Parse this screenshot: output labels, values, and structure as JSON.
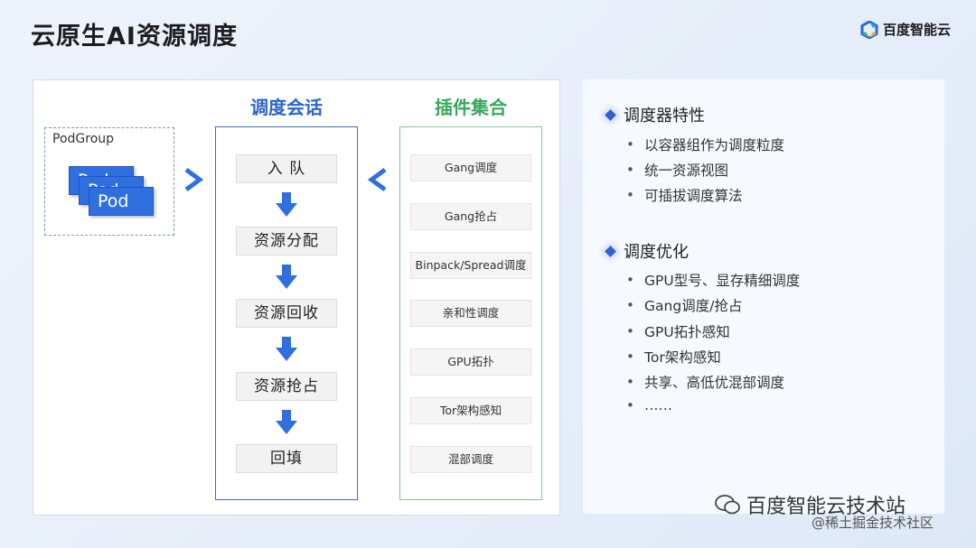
{
  "title": "云原生AI资源调度",
  "brand": {
    "name": "百度智能云",
    "colors": [
      "#1aa5e0",
      "#2c66d6",
      "#3cb371",
      "#f2a93b"
    ]
  },
  "left": {
    "podgroup_label": "PodGroup",
    "pods": [
      "Pod",
      "Pod",
      "Pod"
    ],
    "session": {
      "title": "调度会话",
      "steps": [
        "入 队",
        "资源分配",
        "资源回收",
        "资源抢占",
        "回填"
      ]
    },
    "plugins": {
      "title": "插件集合",
      "items": [
        "Gang调度",
        "Gang抢占",
        "Binpack/Spread调度",
        "亲和性调度",
        "GPU拓扑",
        "Tor架构感知",
        "混部调度"
      ]
    }
  },
  "right": {
    "sections": [
      {
        "title": "调度器特性",
        "items": [
          "以容器组作为调度粒度",
          "统一资源视图",
          "可插拔调度算法"
        ]
      },
      {
        "title": "调度优化",
        "items": [
          "GPU型号、显存精细调度",
          "Gang调度/抢占",
          "GPU拓扑感知",
          "Tor架构感知",
          "共享、高低优混部调度",
          "……"
        ]
      }
    ]
  },
  "watermark": {
    "main": "百度智能云技术站",
    "sub": "@稀土掘金技术社区"
  },
  "colors": {
    "accent_blue": "#2f6fe0",
    "session_title": "#2a66cc",
    "plugin_title": "#37a85a",
    "plugin_border": "#7cca8c"
  }
}
